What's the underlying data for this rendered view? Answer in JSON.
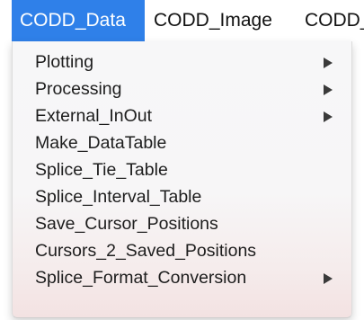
{
  "menubar": {
    "menus": [
      {
        "label": "CODD_Data",
        "active": true
      },
      {
        "label": "CODD_Image",
        "active": false
      },
      {
        "label": "CODD_",
        "active": false
      }
    ]
  },
  "dropdown": {
    "items": [
      {
        "label": "Plotting",
        "has_submenu": true,
        "icon": "submenu-arrow-icon"
      },
      {
        "label": "Processing",
        "has_submenu": true,
        "icon": "submenu-arrow-icon"
      },
      {
        "label": "External_InOut",
        "has_submenu": true,
        "icon": "submenu-arrow-icon"
      },
      {
        "label": "Make_DataTable",
        "has_submenu": false
      },
      {
        "label": "Splice_Tie_Table",
        "has_submenu": false
      },
      {
        "label": "Splice_Interval_Table",
        "has_submenu": false
      },
      {
        "label": "Save_Cursor_Positions",
        "has_submenu": false
      },
      {
        "label": "Cursors_2_Saved_Positions",
        "has_submenu": false
      },
      {
        "label": "Splice_Format_Conversion",
        "has_submenu": true,
        "icon": "submenu-arrow-icon"
      }
    ]
  },
  "colors": {
    "accent": "#2f80e9",
    "menu_background": "#f7f6f7",
    "text": "#1d1d1d"
  }
}
